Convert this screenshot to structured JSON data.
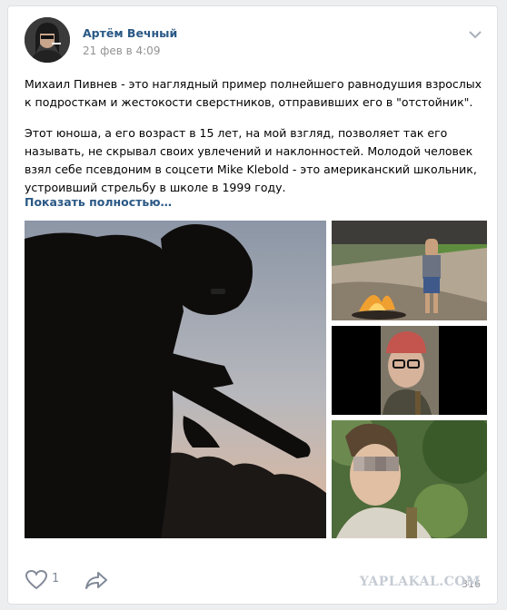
{
  "post": {
    "author": "Артём Вечный",
    "date": "21 фев в 4:09",
    "paragraphs": [
      "Михаил Пивнев - это наглядный пример полнейшего равнодушия взрослых к подросткам и жестокости сверстников, отправивших его в \"отстойник\".",
      "Этот юноша, а его возраст в 15 лет, на мой взгляд, позволяет так его называть, не скрывал своих увлечений и наклонностей. Молодой человек взял себе псевдоним в соцсети Mike Klebold - это американский школьник, устроивший стрельбу в школе в 1999 году."
    ],
    "show_more": "Показать полностью…",
    "likes": "1",
    "views": "316",
    "watermark": "YAPLAKAL.COM"
  },
  "icons": {
    "menu": "chevron-down-icon",
    "like": "heart-icon",
    "share": "share-arrow-icon"
  },
  "colors": {
    "link": "#2a5885",
    "muted": "#939393",
    "background": "#edeef0"
  }
}
